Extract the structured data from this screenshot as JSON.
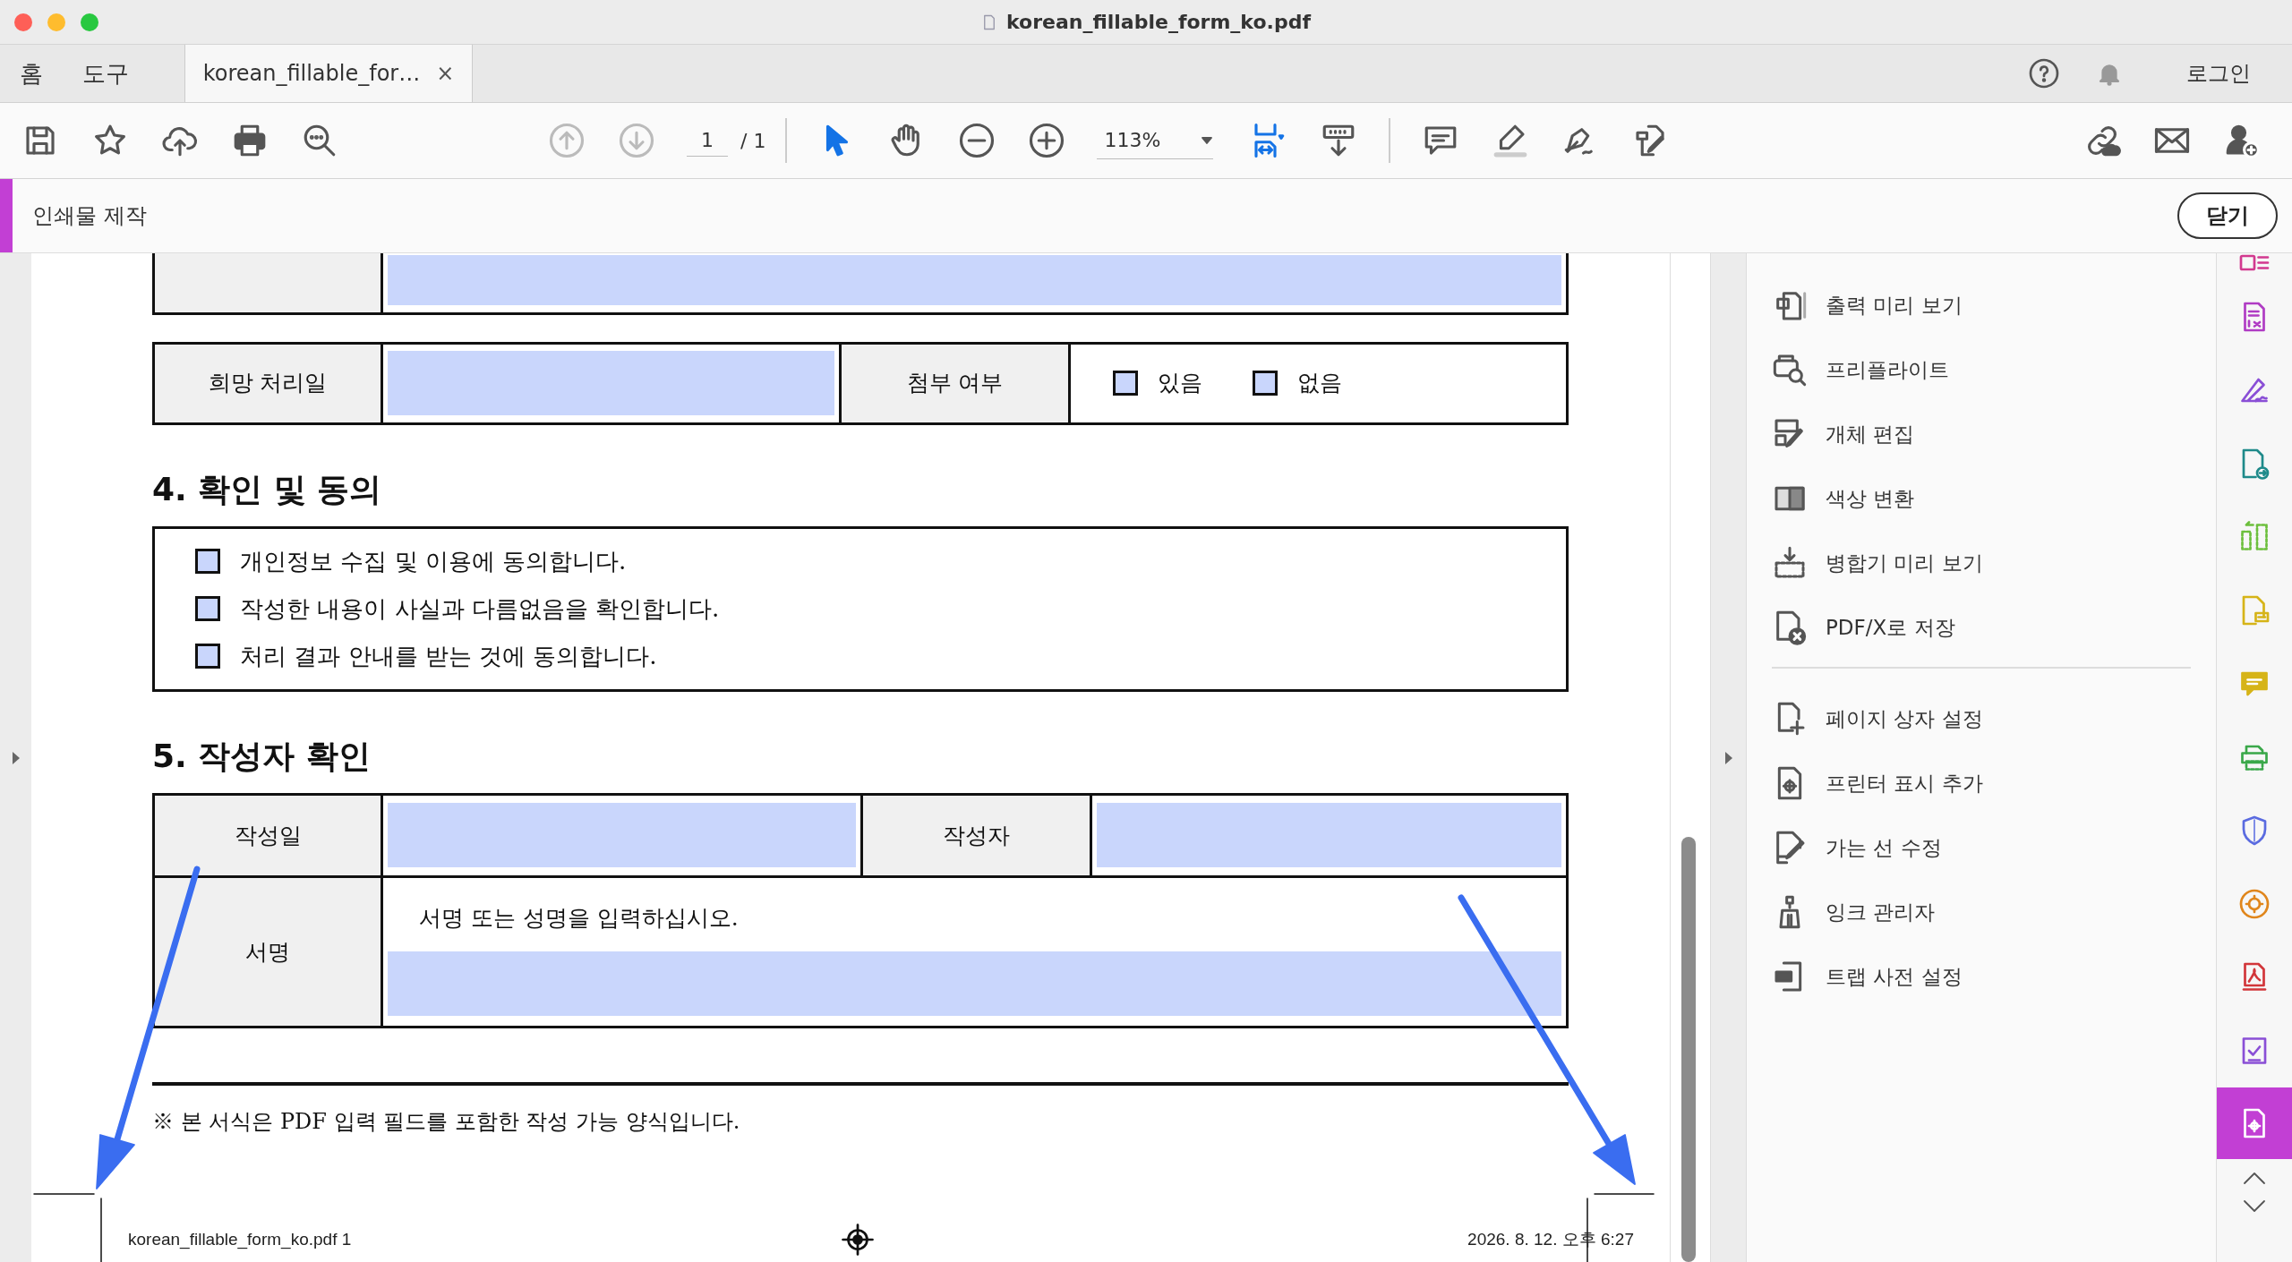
{
  "window": {
    "title": "korean_fillable_form_ko.pdf"
  },
  "tabs": [
    {
      "label": "홈",
      "selected": false
    },
    {
      "label": "도구",
      "selected": false
    },
    {
      "label": "korean_fillable_for…",
      "selected": true,
      "close": "×"
    }
  ],
  "account": {
    "login": "로그인"
  },
  "toolbar": {
    "page_current": "1",
    "page_total": "/ 1",
    "zoom": "113%"
  },
  "tool_header": {
    "title": "인쇄물 제작",
    "close": "닫기"
  },
  "document": {
    "request_row": {
      "date_label": "희망 처리일",
      "attach_label": "첨부 여부",
      "options": [
        {
          "label": "있음",
          "checked": false
        },
        {
          "label": "없음",
          "checked": false
        }
      ]
    },
    "section4": {
      "heading": "4. 확인 및 동의",
      "items": [
        {
          "label": "개인정보 수집 및 이용에 동의합니다.",
          "checked": false
        },
        {
          "label": "작성한 내용이 사실과 다름없음을 확인합니다.",
          "checked": false
        },
        {
          "label": "처리 결과 안내를 받는 것에 동의합니다.",
          "checked": false
        }
      ]
    },
    "section5": {
      "heading": "5. 작성자 확인",
      "date_label": "작성일",
      "author_label": "작성자",
      "sign_label": "서명",
      "sign_hint": "서명 또는 성명을 입력하십시오."
    },
    "note": "※ 본 서식은 PDF 입력 필드를 포함한 작성 가능 양식입니다.",
    "print_marks": {
      "footer_file": "korean_fillable_form_ko.pdf   1",
      "footer_date": "2026. 8. 12.  오후 6:27"
    }
  },
  "panel": {
    "groups": [
      [
        {
          "label": "출력 미리 보기"
        },
        {
          "label": "프리플라이트"
        },
        {
          "label": "개체 편집"
        },
        {
          "label": "색상 변환"
        },
        {
          "label": "병합기 미리 보기"
        },
        {
          "label": "PDF/X로 저장"
        }
      ],
      [
        {
          "label": "페이지 상자 설정"
        },
        {
          "label": "프린터 표시 추가"
        },
        {
          "label": "가는 선 수정"
        },
        {
          "label": "잉크 관리자"
        },
        {
          "label": "트랩 사전 설정"
        }
      ]
    ]
  },
  "rail": [
    {
      "color": "#d2398f",
      "selected": false
    },
    {
      "color": "#b03cc4",
      "selected": false
    },
    {
      "color": "#8a4fd6",
      "selected": false
    },
    {
      "color": "#1f8a8a",
      "selected": false
    },
    {
      "color": "#6cbf3c",
      "selected": false
    },
    {
      "color": "#d6b418",
      "selected": false
    },
    {
      "color": "#d6b418",
      "selected": false
    },
    {
      "color": "#3aa84a",
      "selected": false
    },
    {
      "color": "#5a6be0",
      "selected": false
    },
    {
      "color": "#e0861c",
      "selected": false
    },
    {
      "color": "#d2363a",
      "selected": false
    },
    {
      "color": "#8a4fd6",
      "selected": false
    },
    {
      "color": "#c23fd4",
      "selected": true
    }
  ]
}
